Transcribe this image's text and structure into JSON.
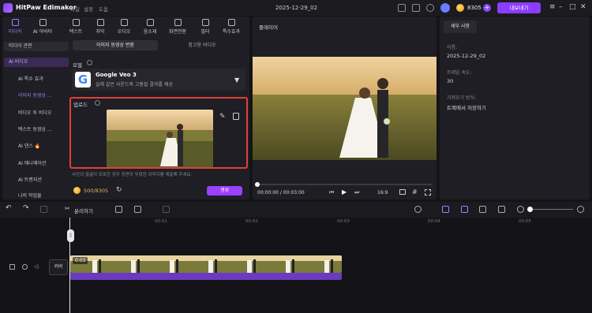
{
  "app": {
    "name": "HitPaw Edimakor",
    "menu": [
      "파일",
      "설정",
      "도움"
    ],
    "project_title": "2025-12-29_02",
    "credits": "8305",
    "export_label": "내보내기"
  },
  "topnav": [
    {
      "label": "미디어",
      "active": true
    },
    {
      "label": "AI 아바타"
    },
    {
      "label": "텍스트"
    },
    {
      "label": "자막"
    },
    {
      "label": "오디오"
    },
    {
      "label": "음소재"
    },
    {
      "label": "화면전환"
    },
    {
      "label": "필터"
    },
    {
      "label": "특수효과"
    }
  ],
  "sidebar": {
    "items": [
      {
        "label": "미디어 관련"
      },
      {
        "label": "AI 비디오",
        "selected": true
      }
    ],
    "subitems": [
      {
        "label": "AI 특수 효과"
      },
      {
        "label": "이미지 동영상 ...",
        "selected": true
      },
      {
        "label": "비디오 투 비디오"
      },
      {
        "label": "텍스트 동영상 ..."
      },
      {
        "label": "AI 댄스 🔥"
      },
      {
        "label": "AI 애니메이션"
      },
      {
        "label": "AI 트랜지션"
      },
      {
        "label": "나의 작업물"
      }
    ]
  },
  "tabs": [
    {
      "label": "이미지 동영상 변환",
      "active": true
    },
    {
      "label": "참고용 비디오"
    }
  ],
  "model": {
    "section_label": "모델",
    "name": "Google Veo 3",
    "description": "실제 같은 사운드와 고품질 결과를 제공"
  },
  "upload": {
    "section_label": "업로드",
    "note": "사진의 얼굴이 모호한 경우 정면의 뚜렷한 이미지를 제출해 주세요."
  },
  "generate": {
    "credits": "500/8305",
    "button_label": "생성"
  },
  "player": {
    "title": "플레이어",
    "time": "00:00:00 / 00:03:00",
    "aspect": "16:9"
  },
  "details": {
    "tab": "세부 사항",
    "name_label": "이름:",
    "name_value": "2025-12-29_02",
    "fps_label": "프레임 속도:",
    "fps_value": "30",
    "import_label": "가져오기 방식:",
    "import_value": "트랙에서 저장하기"
  },
  "timeline": {
    "split_label": "분리하기",
    "ticks": [
      "00:01",
      "00:02",
      "00:03",
      "00:04",
      "00:05"
    ],
    "track_label": "커버",
    "clip_duration": "0:03"
  },
  "colors": {
    "accent": "#8b3dff",
    "highlight": "#e0403a"
  }
}
